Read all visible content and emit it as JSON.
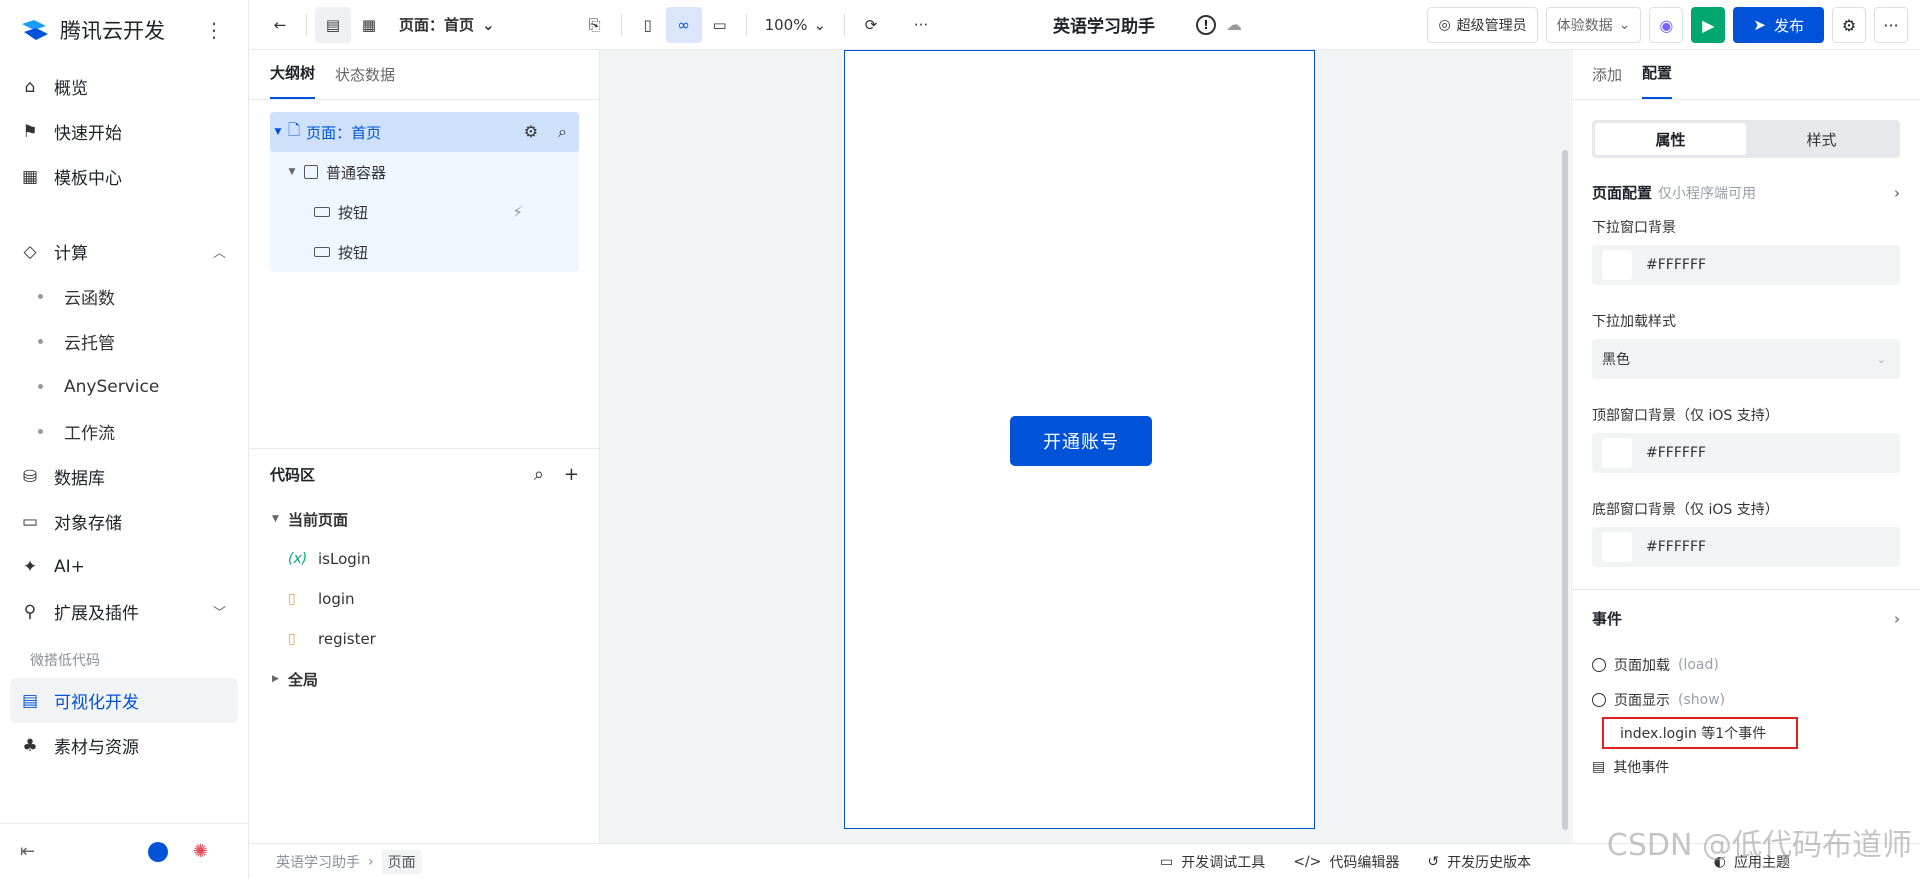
{
  "brand": {
    "title": "腾讯云开发"
  },
  "nav": {
    "items": [
      {
        "label": "概览"
      },
      {
        "label": "快速开始"
      },
      {
        "label": "模板中心"
      }
    ],
    "compute": {
      "label": "计算",
      "children": [
        "云函数",
        "云托管",
        "AnyService",
        "工作流"
      ]
    },
    "more": [
      {
        "label": "数据库"
      },
      {
        "label": "对象存储"
      },
      {
        "label": "AI+"
      },
      {
        "label": "扩展及插件"
      }
    ],
    "section": "微搭低代码",
    "lowcode": [
      {
        "label": "可视化开发"
      },
      {
        "label": "素材与资源"
      }
    ]
  },
  "toolbar": {
    "page_select": "页面：首页",
    "zoom": "100%",
    "app_title": "英语学习助手",
    "admin": "超级管理员",
    "data_source": "体验数据",
    "publish": "发布"
  },
  "outline": {
    "tabs": [
      "大纲树",
      "状态数据"
    ],
    "tree": {
      "page": "页面：首页",
      "container": "普通容器",
      "button1": "按钮",
      "button2": "按钮"
    }
  },
  "code": {
    "title": "代码区",
    "current_page": "当前页面",
    "items": [
      "isLogin",
      "login",
      "register"
    ],
    "global": "全局"
  },
  "canvas": {
    "button_label": "开通账号"
  },
  "right": {
    "tabs": [
      "添加",
      "配置"
    ],
    "segments": [
      "属性",
      "样式"
    ],
    "page_config": "页面配置",
    "page_config_hint": "仅小程序端可用",
    "fields": [
      {
        "label": "下拉窗口背景",
        "value": "#FFFFFF"
      },
      {
        "label": "下拉加载样式",
        "value": "黑色"
      },
      {
        "label": "顶部窗口背景（仅 iOS 支持）",
        "value": "#FFFFFF"
      },
      {
        "label": "底部窗口背景（仅 iOS 支持）",
        "value": "#FFFFFF"
      }
    ],
    "events_title": "事件",
    "events": [
      {
        "label": "页面加载",
        "hint": "(load)"
      },
      {
        "label": "页面显示",
        "hint": "(show)"
      }
    ],
    "event_highlight": "index.login 等1个事件",
    "other_events": "其他事件"
  },
  "footer": {
    "crumb": [
      "英语学习助手",
      "页面"
    ],
    "tools": [
      "开发调试工具",
      "代码编辑器",
      "开发历史版本"
    ],
    "apply_theme": "应用主题"
  },
  "watermark": "CSDN @低代码布道师",
  "colors": {
    "accent": "#0052d9",
    "run": "#00a870",
    "highlight_border": "#e02020"
  }
}
